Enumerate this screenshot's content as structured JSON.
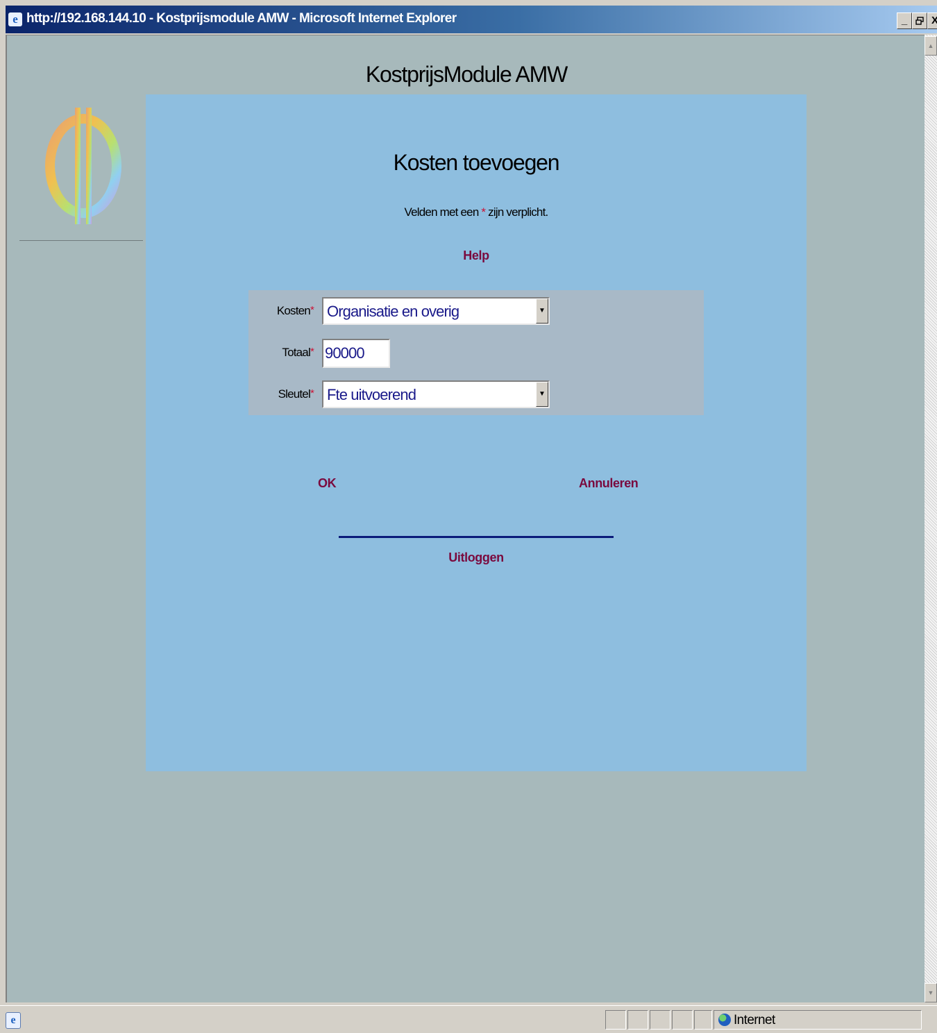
{
  "window": {
    "title": "http://192.168.144.10 - Kostprijsmodule AMW - Microsoft Internet Explorer",
    "minimize_glyph": "_",
    "restore_glyph": "🗗",
    "close_glyph": "X"
  },
  "page": {
    "app_title": "KostprijsModule AMW",
    "form_title": "Kosten toevoegen",
    "required_note": {
      "before": "Velden met een ",
      "marker": "*",
      "after": " zijn verplicht."
    },
    "help_link": "Help",
    "fields": {
      "kosten": {
        "label": "Kosten",
        "marker": "*",
        "value": "Organisatie en overig"
      },
      "totaal": {
        "label": "Totaal",
        "marker": "*",
        "value": "90000"
      },
      "sleutel": {
        "label": "Sleutel",
        "marker": "*",
        "value": "Fte uitvoerend"
      }
    },
    "ok_link": "OK",
    "cancel_link": "Annuleren",
    "logout_link": "Uitloggen"
  },
  "statusbar": {
    "zone": "Internet"
  },
  "icons": {
    "browser": "ie-icon",
    "logo": "euro-logo",
    "zone": "globe-icon",
    "dropdown": "chevron-down-icon"
  },
  "colors": {
    "page_background": "#a7b9bb",
    "panel_background": "#8ebedf",
    "form_background": "#a8b9c7",
    "link": "#7a0a3e",
    "required_marker": "#cc1133",
    "field_text": "#1a1a8a"
  }
}
